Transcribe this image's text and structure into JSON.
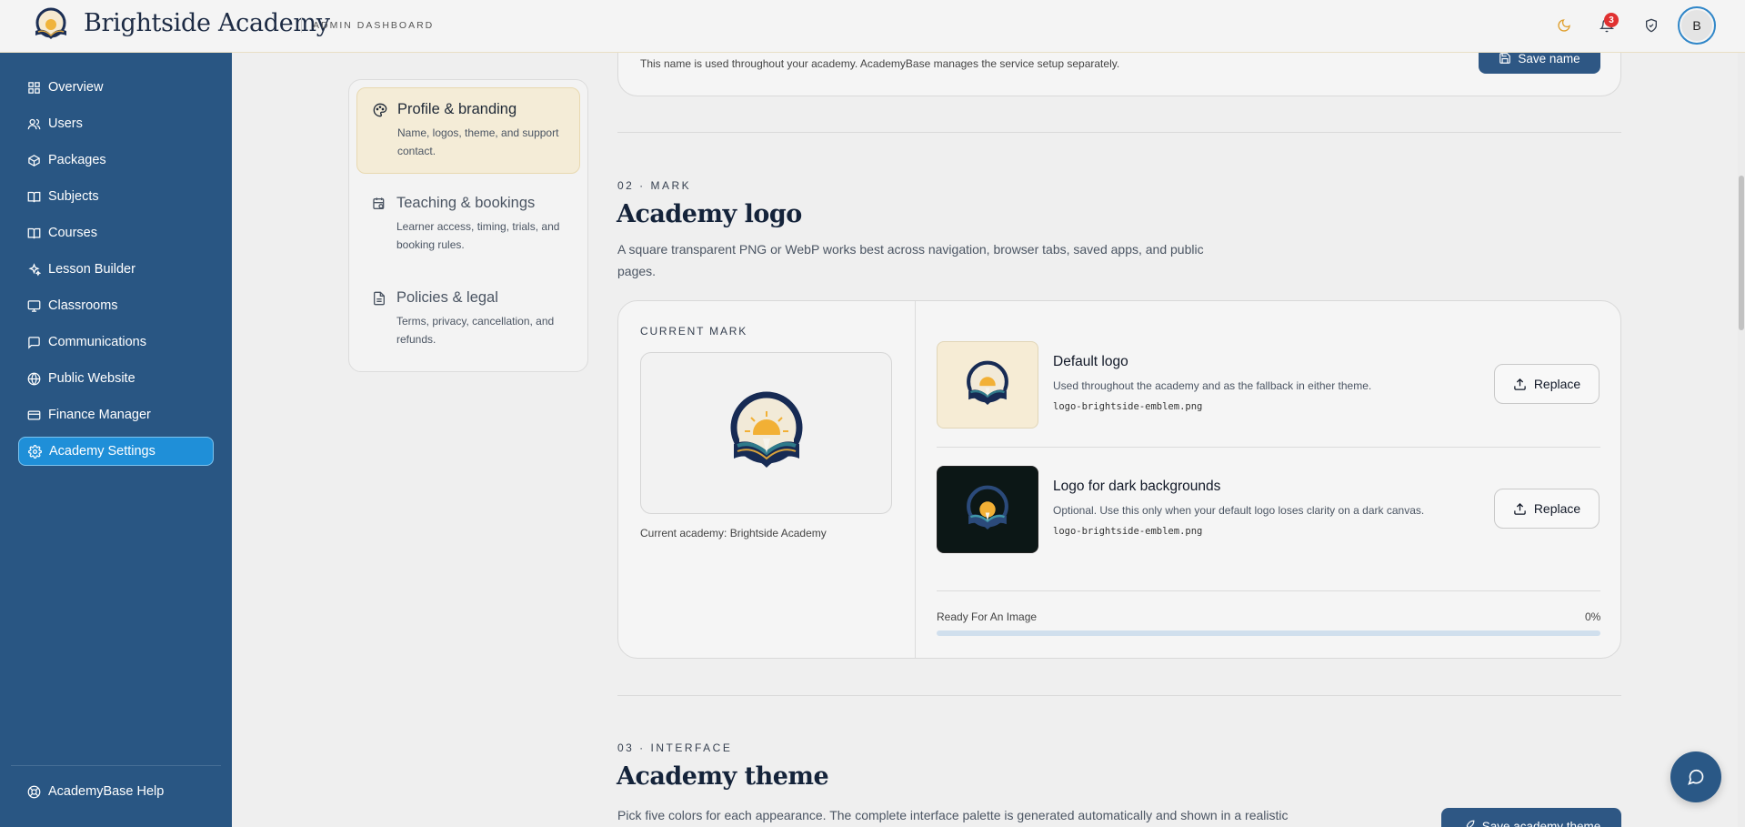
{
  "header": {
    "brand_name": "Brightside Academy",
    "tagline": "ADMIN DASHBOARD",
    "notification_count": "3",
    "avatar_initial": "B"
  },
  "sidebar": {
    "items": [
      {
        "label": "Overview",
        "icon": "grid-icon"
      },
      {
        "label": "Users",
        "icon": "users-icon"
      },
      {
        "label": "Packages",
        "icon": "package-icon"
      },
      {
        "label": "Subjects",
        "icon": "book-icon"
      },
      {
        "label": "Courses",
        "icon": "book-open-icon"
      },
      {
        "label": "Lesson Builder",
        "icon": "sparkles-icon"
      },
      {
        "label": "Classrooms",
        "icon": "monitor-icon"
      },
      {
        "label": "Communications",
        "icon": "message-icon"
      },
      {
        "label": "Public Website",
        "icon": "globe-icon"
      },
      {
        "label": "Finance Manager",
        "icon": "card-icon"
      },
      {
        "label": "Academy Settings",
        "icon": "gear-icon",
        "active": true
      }
    ],
    "help_label": "AcademyBase Help"
  },
  "settings_nav": [
    {
      "title": "Profile & branding",
      "desc": "Name, logos, theme, and support contact.",
      "active": true
    },
    {
      "title": "Teaching & bookings",
      "desc": "Learner access, timing, trials, and booking rules."
    },
    {
      "title": "Policies & legal",
      "desc": "Terms, privacy, cancellation, and refunds."
    }
  ],
  "name_section": {
    "help_text": "This name is used throughout your academy. AcademyBase manages the service setup separately.",
    "save_label": "Save name"
  },
  "mark_section": {
    "eyebrow": "02 · MARK",
    "title": "Academy logo",
    "lead": "A square transparent PNG or WebP works best across navigation, browser tabs, saved apps, and public pages.",
    "current_mark_label": "CURRENT MARK",
    "current_caption": "Current academy: Brightside Academy",
    "logos": [
      {
        "title": "Default logo",
        "desc": "Used throughout the academy and as the fallback in either theme.",
        "file": "logo-brightside-emblem.png",
        "replace_label": "Replace"
      },
      {
        "title": "Logo for dark backgrounds",
        "desc": "Optional. Use this only when your default logo loses clarity on a dark canvas.",
        "file": "logo-brightside-emblem.png",
        "replace_label": "Replace"
      }
    ],
    "progress_label": "Ready For An Image",
    "progress_value": "0%",
    "progress_fraction": 0
  },
  "theme_section": {
    "eyebrow": "03 · INTERFACE",
    "title": "Academy theme",
    "lead": "Pick five colors for each appearance. The complete interface palette is generated automatically and shown in a realistic",
    "save_label": "Save academy theme"
  },
  "colors": {
    "sidebar": "#295683",
    "active_nav": "#1f8fd8",
    "primary_button": "#2e5784",
    "badge": "#e03131",
    "active_subnav": "#f4ecd7",
    "moon_icon": "#e0a030"
  }
}
